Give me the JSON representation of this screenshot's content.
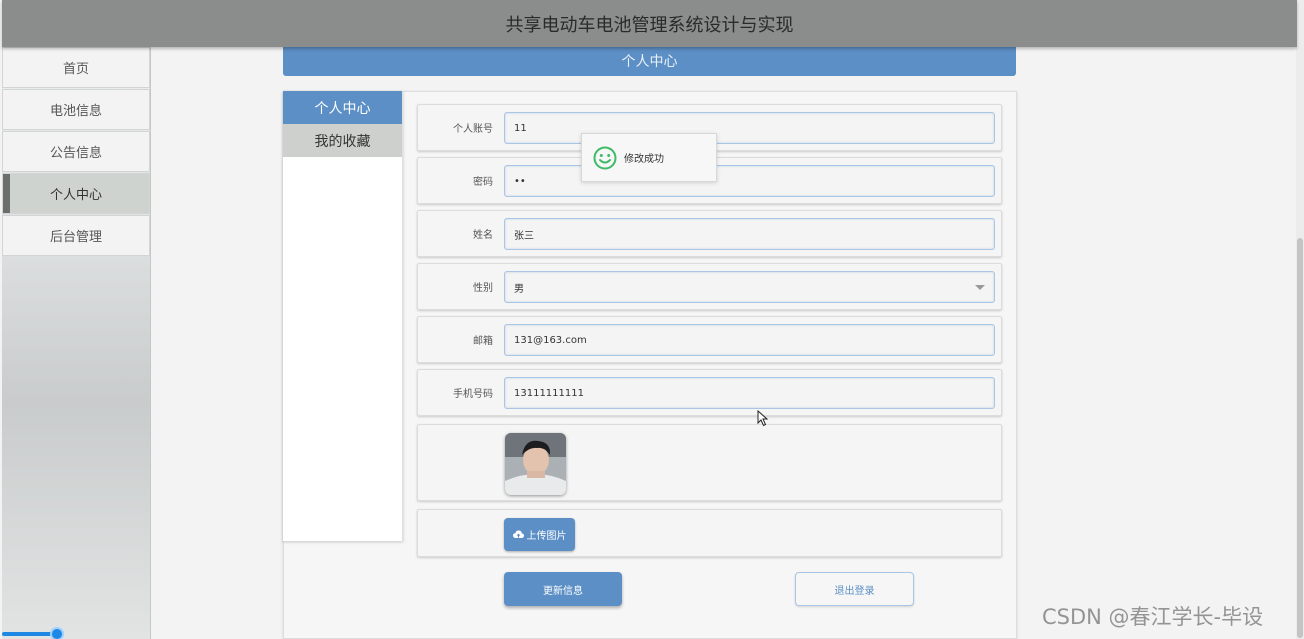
{
  "header": {
    "title": "共享电动车电池管理系统设计与实现"
  },
  "sidebar": {
    "items": [
      {
        "label": "首页"
      },
      {
        "label": "电池信息"
      },
      {
        "label": "公告信息"
      },
      {
        "label": "个人中心"
      },
      {
        "label": "后台管理"
      }
    ],
    "active_index": 3
  },
  "page": {
    "title": "个人中心"
  },
  "tabs": [
    {
      "label": "个人中心"
    },
    {
      "label": "我的收藏"
    }
  ],
  "form": {
    "account": {
      "label": "个人账号",
      "value": "11"
    },
    "password": {
      "label": "密码",
      "value": "••"
    },
    "name": {
      "label": "姓名",
      "value": "张三"
    },
    "gender": {
      "label": "性别",
      "value": "男"
    },
    "email": {
      "label": "邮箱",
      "value": "131@163.com"
    },
    "phone": {
      "label": "手机号码",
      "value": "13111111111"
    },
    "upload_label": "上传图片"
  },
  "buttons": {
    "update": "更新信息",
    "logout": "退出登录"
  },
  "toast": {
    "message": "修改成功",
    "icon": "smiley-icon"
  },
  "watermark": {
    "text": "CSDN @春江学长-毕设"
  },
  "colors": {
    "accent": "#5c8fc5",
    "topbar": "#8a8d8b",
    "tab_inactive": "#cdd0cd"
  }
}
